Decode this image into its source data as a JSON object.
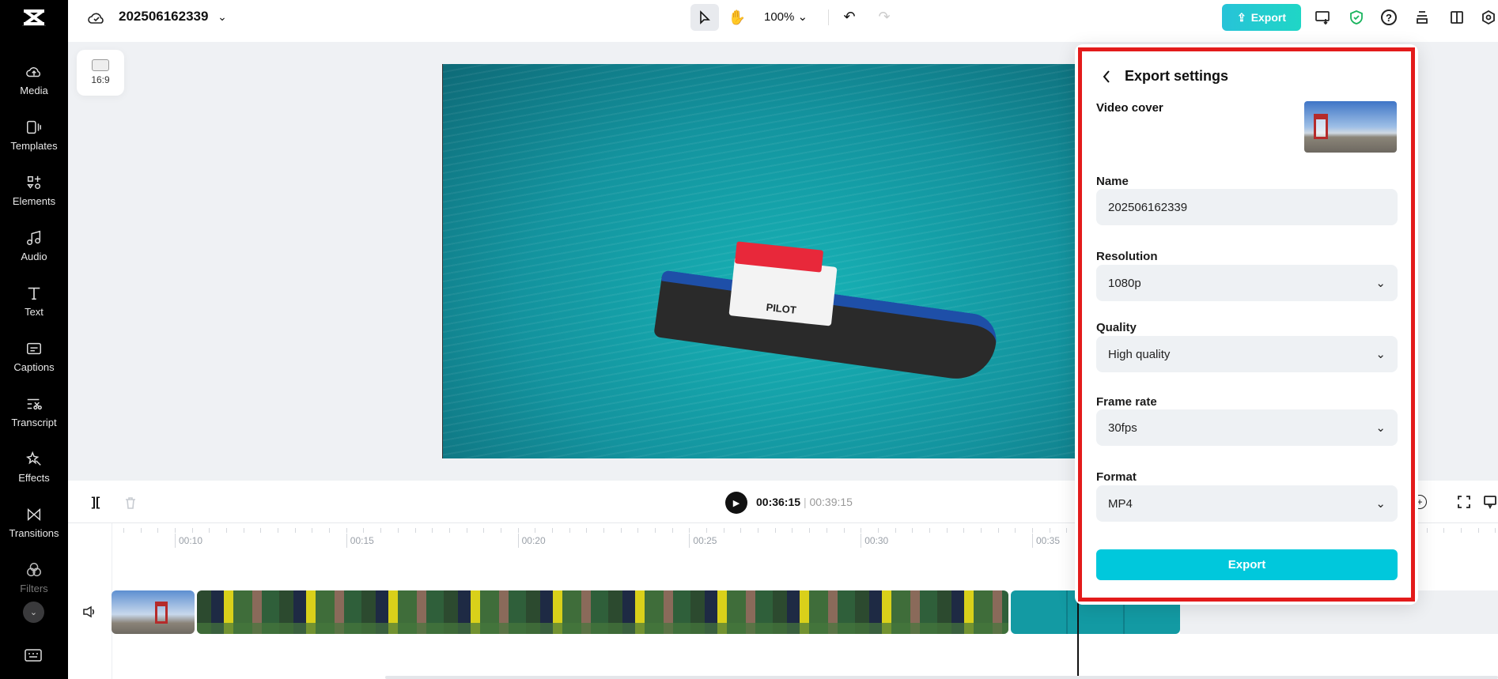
{
  "sidebar": {
    "items": [
      {
        "label": "Media",
        "icon": "media-upload-icon"
      },
      {
        "label": "Templates",
        "icon": "templates-icon"
      },
      {
        "label": "Elements",
        "icon": "elements-icon"
      },
      {
        "label": "Audio",
        "icon": "audio-icon"
      },
      {
        "label": "Text",
        "icon": "text-icon"
      },
      {
        "label": "Captions",
        "icon": "captions-icon"
      },
      {
        "label": "Transcript",
        "icon": "transcript-icon"
      },
      {
        "label": "Effects",
        "icon": "effects-icon"
      },
      {
        "label": "Transitions",
        "icon": "transitions-icon"
      },
      {
        "label": "Filters",
        "icon": "filters-icon"
      }
    ]
  },
  "header": {
    "project_name": "202506162339",
    "zoom": "100%",
    "export_label": "Export"
  },
  "canvas": {
    "aspect_ratio": "16:9",
    "boat_text": "PILOT"
  },
  "timeline": {
    "current_time": "00:36:15",
    "separator": "|",
    "total_time": "00:39:15",
    "ruler": [
      "00:10",
      "00:15",
      "00:20",
      "00:25",
      "00:30",
      "00:35"
    ]
  },
  "export_panel": {
    "title": "Export settings",
    "video_cover_label": "Video cover",
    "name_label": "Name",
    "name_value": "202506162339",
    "resolution_label": "Resolution",
    "resolution_value": "1080p",
    "quality_label": "Quality",
    "quality_value": "High quality",
    "frame_rate_label": "Frame rate",
    "frame_rate_value": "30fps",
    "format_label": "Format",
    "format_value": "MP4",
    "export_button": "Export"
  },
  "colors": {
    "accent": "#00c8dc",
    "highlight_border": "#e31b1b",
    "sidebar": "#000000"
  }
}
